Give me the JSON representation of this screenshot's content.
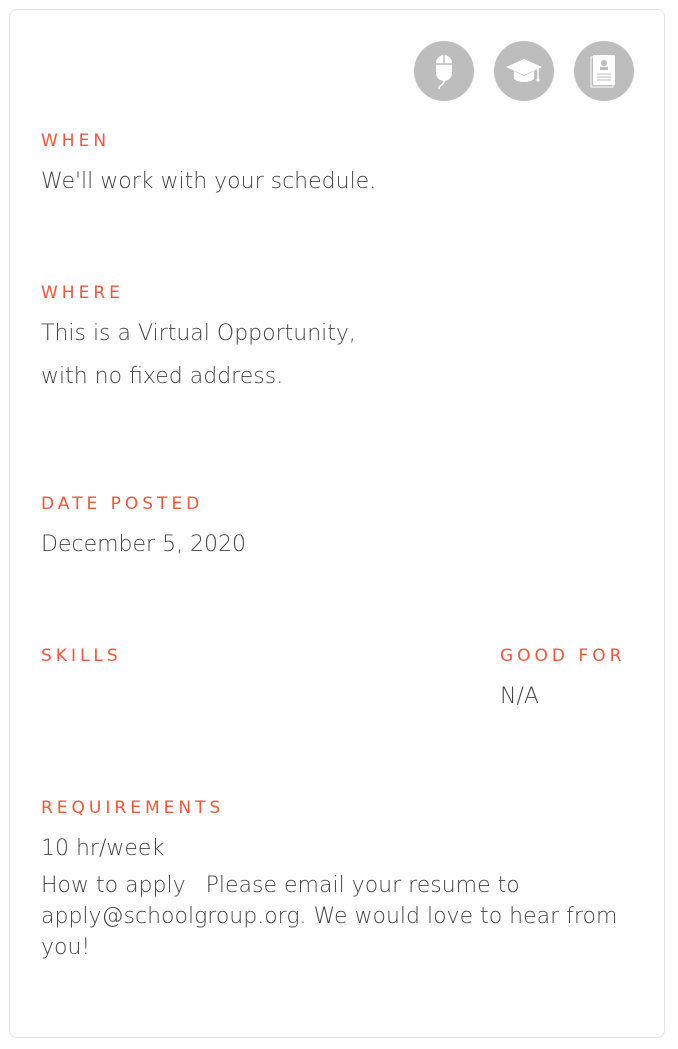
{
  "icons": [
    {
      "name": "mouse-icon"
    },
    {
      "name": "graduation-cap-icon"
    },
    {
      "name": "resume-document-icon"
    }
  ],
  "when": {
    "label": "WHEN",
    "value": "We'll work with your schedule."
  },
  "where": {
    "label": "WHERE",
    "line1": "This is a Virtual Opportunity,",
    "line2": "with no fixed address."
  },
  "date_posted": {
    "label": "DATE POSTED",
    "value": "December 5, 2020"
  },
  "skills": {
    "label": "SKILLS"
  },
  "good_for": {
    "label": "GOOD FOR",
    "value": "N/A"
  },
  "requirements": {
    "label": "REQUIREMENTS",
    "hours": "10 hr/week",
    "how_to_apply_label": "How to apply",
    "how_to_apply_text": "Please email your resume to",
    "email": "apply@schoolgroup.org",
    "closing": ". We would love to hear from you!"
  },
  "colors": {
    "label": "#f0573b",
    "icon_bg": "#bdbdbd",
    "text": "#444444"
  }
}
